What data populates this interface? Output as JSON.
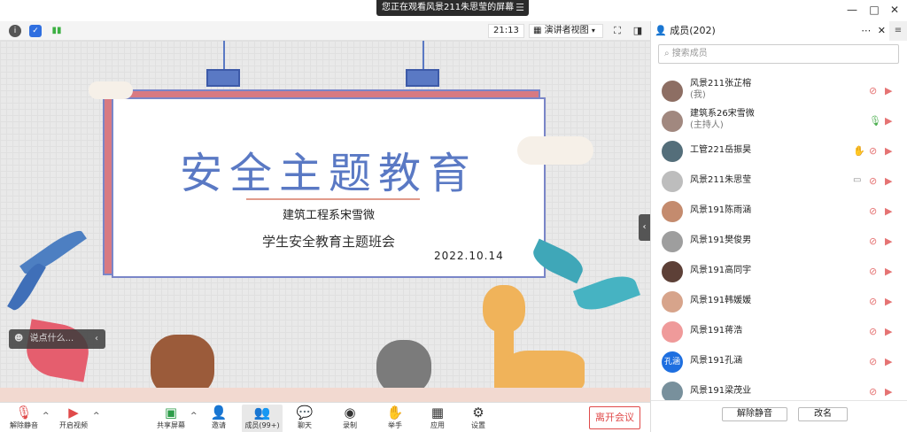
{
  "window": {
    "share_banner": "您正在观看风景211朱思莹的屏幕",
    "banner_menu_icon": "menu-icon",
    "controls": [
      "minimize-icon",
      "maximize-icon",
      "close-icon"
    ]
  },
  "toolbar": {
    "time": "21:13",
    "view_label": "演讲者视图"
  },
  "slide": {
    "title": "安全主题教育",
    "author": "建筑工程系宋雪微",
    "subtitle": "学生安全教育主题班会",
    "date": "2022.10.14"
  },
  "chat_pill": {
    "placeholder": "说点什么..."
  },
  "bottom": {
    "unmute": "解除静音",
    "video": "开启视频",
    "share": "共享屏幕",
    "invite": "邀请",
    "members": "成员(99+)",
    "chat": "聊天",
    "record": "录制",
    "raise": "举手",
    "apps": "应用",
    "settings": "设置",
    "leave": "离开会议"
  },
  "panel": {
    "title": "成员(202)",
    "search_placeholder": "搜索成员",
    "members": [
      {
        "name": "风景211张芷榕",
        "role": "(我)",
        "color": "#8d6e63"
      },
      {
        "name": "建筑系26宋雪微",
        "role": "(主持人)",
        "color": "#a1887f",
        "mic_on": true
      },
      {
        "name": "工管221岳振昊",
        "role": "",
        "color": "#546e7a",
        "hand": true
      },
      {
        "name": "风景211朱思莹",
        "role": "",
        "color": "#bdbdbd",
        "screen": true
      },
      {
        "name": "风景191陈雨涵",
        "role": "",
        "color": "#c48b6e"
      },
      {
        "name": "风景191樊俊男",
        "role": "",
        "color": "#9e9e9e"
      },
      {
        "name": "风景191高同宇",
        "role": "",
        "color": "#5d4037"
      },
      {
        "name": "风景191韩媛媛",
        "role": "",
        "color": "#d7a48b"
      },
      {
        "name": "风景191蒋浩",
        "role": "",
        "color": "#ef9a9a"
      },
      {
        "name": "风景191孔涵",
        "role": "",
        "color": "#1e6fe0",
        "initials": "孔涵"
      },
      {
        "name": "风景191梁茂业",
        "role": "",
        "color": "#78909c"
      }
    ],
    "footer": {
      "unmute_all": "解除静音",
      "rename": "改名"
    }
  }
}
